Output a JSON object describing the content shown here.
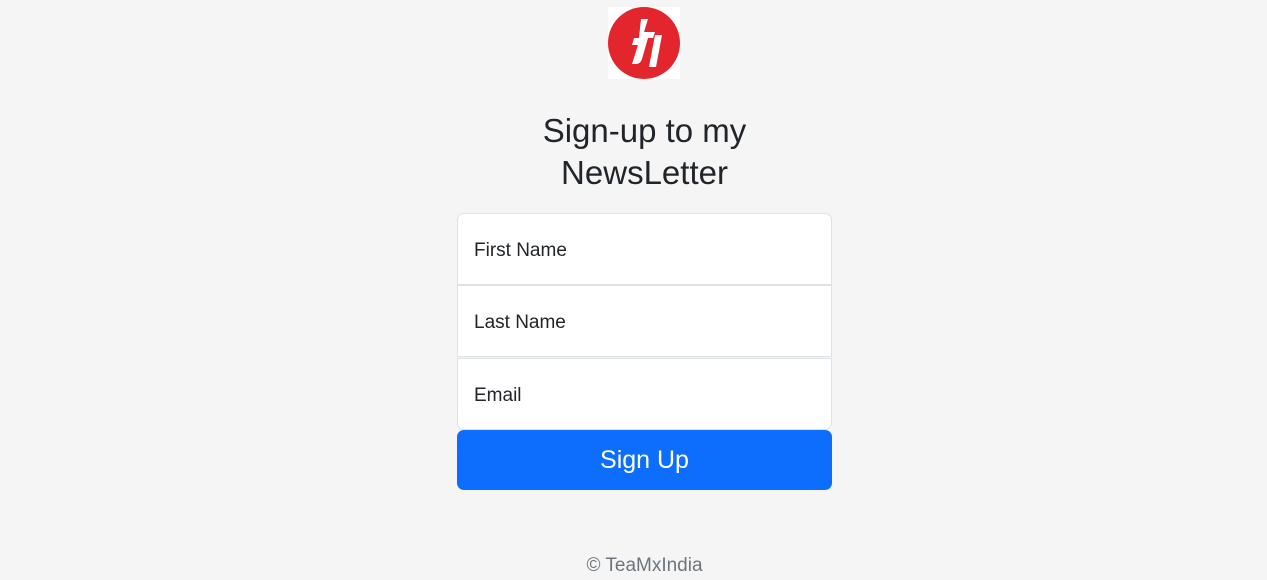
{
  "logo": {
    "icon": "brand-logo-icon",
    "letter": "t",
    "color": "#e3262d"
  },
  "form": {
    "title": "Sign-up to my NewsLetter",
    "first_name_label": "First Name",
    "last_name_label": "Last Name",
    "email_label": "Email",
    "submit_label": "Sign Up",
    "accent": "#0d6efd"
  },
  "footer": {
    "copyright_symbol": "©",
    "copyright_text": "TeaMxIndia"
  }
}
